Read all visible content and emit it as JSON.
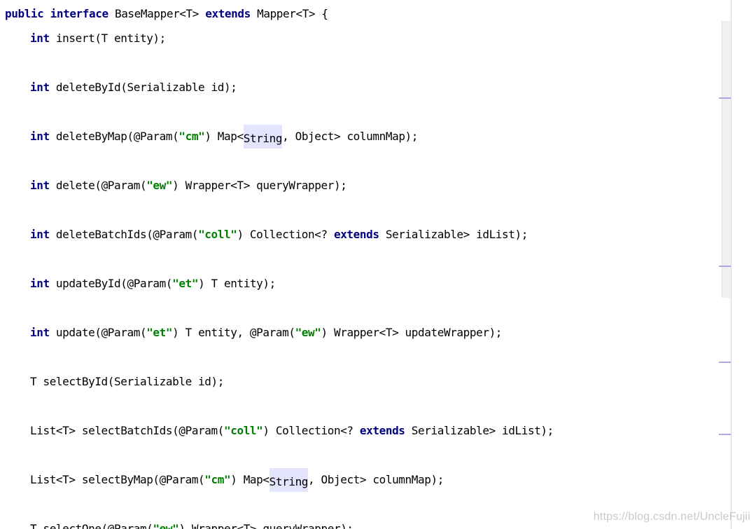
{
  "code_lines": [
    {
      "tokens": [
        {
          "t": "public interface",
          "k": "kw"
        },
        {
          "t": " BaseMapper<T> "
        },
        {
          "t": "extends",
          "k": "kw"
        },
        {
          "t": " Mapper<T> {"
        }
      ]
    },
    {
      "tokens": [
        {
          "t": "int",
          "k": "kw"
        },
        {
          "t": " insert(T entity);"
        }
      ]
    },
    {
      "tokens": [
        {
          "t": "int",
          "k": "kw"
        },
        {
          "t": " deleteById(Serializable id);"
        }
      ]
    },
    {
      "tokens": [
        {
          "t": "int",
          "k": "kw"
        },
        {
          "t": " deleteByMap(@Param("
        },
        {
          "t": "\"cm\"",
          "k": "str"
        },
        {
          "t": ") Map<"
        },
        {
          "t": "String",
          "k": "hl"
        },
        {
          "t": ", Object> columnMap);"
        }
      ]
    },
    {
      "tokens": [
        {
          "t": "int",
          "k": "kw"
        },
        {
          "t": " delete(@Param("
        },
        {
          "t": "\"ew\"",
          "k": "str"
        },
        {
          "t": ") Wrapper<T> queryWrapper);"
        }
      ]
    },
    {
      "tokens": [
        {
          "t": "int",
          "k": "kw"
        },
        {
          "t": " deleteBatchIds(@Param("
        },
        {
          "t": "\"coll\"",
          "k": "str"
        },
        {
          "t": ") Collection<? "
        },
        {
          "t": "extends",
          "k": "kw"
        },
        {
          "t": " Serializable> idList);"
        }
      ]
    },
    {
      "tokens": [
        {
          "t": "int",
          "k": "kw"
        },
        {
          "t": " updateById(@Param("
        },
        {
          "t": "\"et\"",
          "k": "str"
        },
        {
          "t": ") T entity);"
        }
      ]
    },
    {
      "tokens": [
        {
          "t": "int",
          "k": "kw"
        },
        {
          "t": " update(@Param("
        },
        {
          "t": "\"et\"",
          "k": "str"
        },
        {
          "t": ") T entity, @Param("
        },
        {
          "t": "\"ew\"",
          "k": "str"
        },
        {
          "t": ") Wrapper<T> updateWrapper);"
        }
      ]
    },
    {
      "tokens": [
        {
          "t": "T selectById(Serializable id);"
        }
      ]
    },
    {
      "tokens": [
        {
          "t": "List<T> selectBatchIds(@Param("
        },
        {
          "t": "\"coll\"",
          "k": "str"
        },
        {
          "t": ") Collection<? "
        },
        {
          "t": "extends",
          "k": "kw"
        },
        {
          "t": " Serializable> idList);"
        }
      ]
    },
    {
      "tokens": [
        {
          "t": "List<T> selectByMap(@Param("
        },
        {
          "t": "\"cm\"",
          "k": "str"
        },
        {
          "t": ") Map<"
        },
        {
          "t": "String",
          "k": "hl"
        },
        {
          "t": ", Object> columnMap);"
        }
      ]
    },
    {
      "tokens": [
        {
          "t": "T selectOne(@Param("
        },
        {
          "t": "\"ew\"",
          "k": "str"
        },
        {
          "t": ") Wrapper<T> queryWrapper);"
        }
      ]
    }
  ],
  "watermark": "https://blog.csdn.net/UncleFujii",
  "colors": {
    "keyword": "#000080",
    "string": "#008000",
    "highlight": "#e4e4ff",
    "marker": "#a9a9e8"
  }
}
